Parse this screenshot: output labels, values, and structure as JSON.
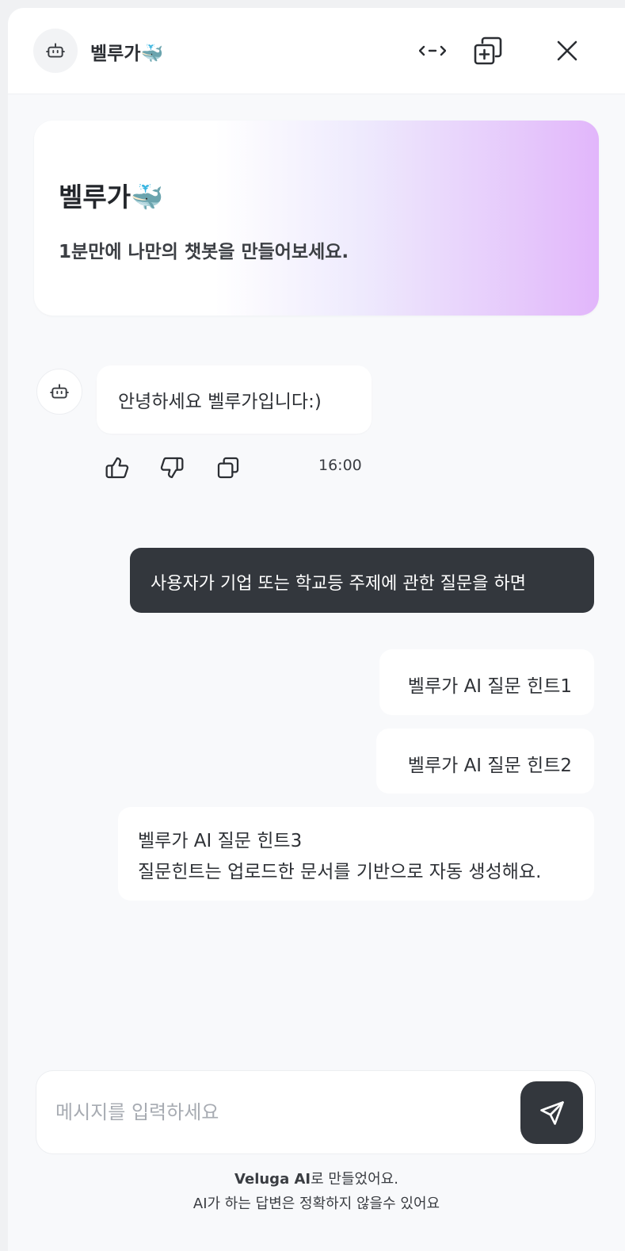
{
  "header": {
    "title": "벨루가🐳",
    "avatar_icon": "robot-icon",
    "expand_icon": "expand-arrows-icon",
    "new_chat_icon": "copy-plus-icon",
    "close_icon": "close-icon"
  },
  "banner": {
    "title": "벨루가🐳",
    "subtitle": "1분만에 나만의 챗봇을 만들어보세요."
  },
  "messages": {
    "bot_greeting": "안녕하세요 벨루가입니다:)",
    "bot_time": "16:00",
    "actions": [
      "thumbs-up-icon",
      "thumbs-down-icon",
      "copy-icon"
    ],
    "user_message": "사용자가 기업 또는 학교등 주제에 관한 질문을 하면"
  },
  "hints": [
    "벨루가 AI 질문 힌트1",
    "벨루가 AI 질문 힌트2",
    "벨루가 AI 질문 힌트3"
  ],
  "hint_note": "질문힌트는 업로드한 문서를 기반으로 자동 생성해요.",
  "composer": {
    "placeholder": "메시지를 입력하세요",
    "send_icon": "send-icon"
  },
  "footer": {
    "brand": "Veluga AI",
    "made_with": "로 만들었어요.",
    "disclaimer": "AI가 하는 답변은 정확하지 않을수 있어요"
  },
  "colors": {
    "dark": "#33373d",
    "background": "#f8f9fb",
    "banner_gradient_end": "#e2b6fb"
  }
}
